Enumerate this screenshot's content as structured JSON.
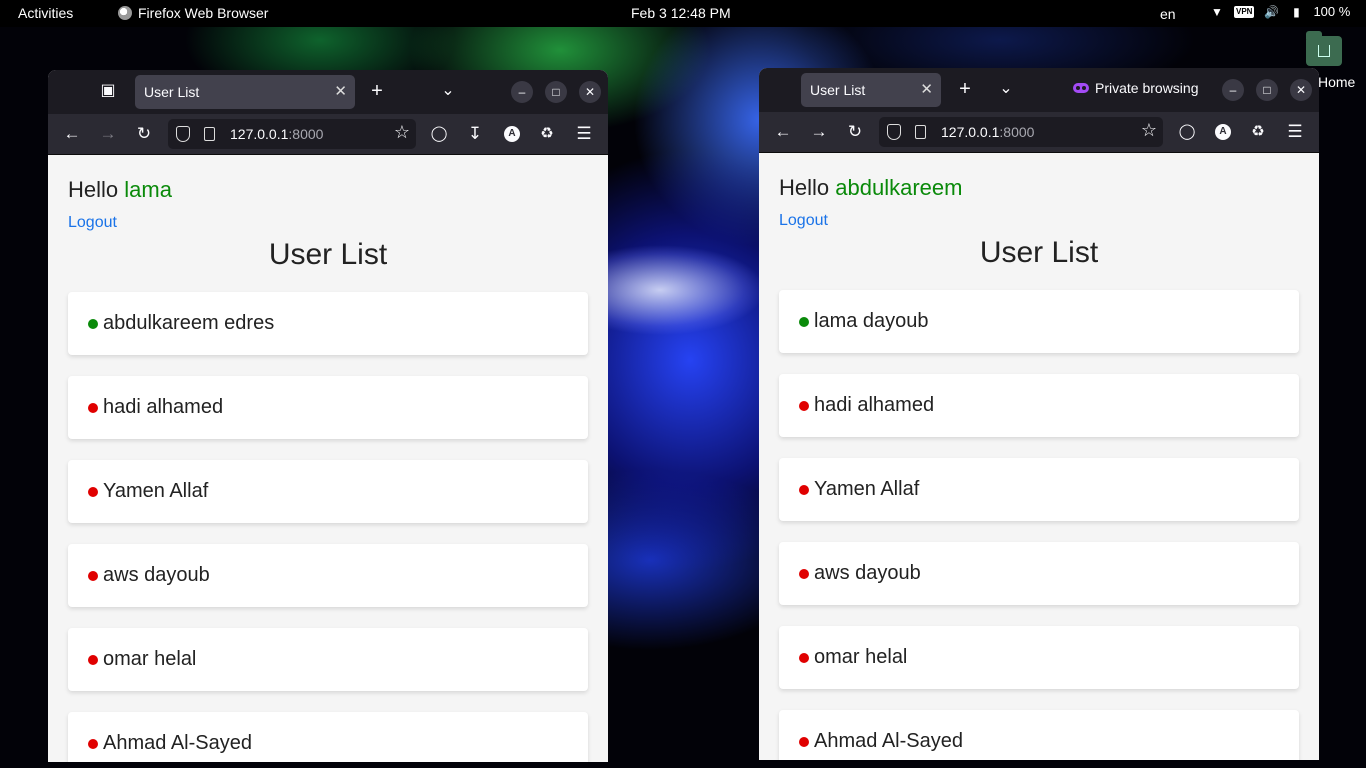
{
  "topbar": {
    "activities": "Activities",
    "app_name": "Firefox Web Browser",
    "clock": "Feb 3  12:48 PM",
    "lang": "en",
    "vpn": "VPN",
    "battery": "100 %"
  },
  "desktop": {
    "home_label": "Home"
  },
  "colors": {
    "online": "#0a8a0a",
    "offline": "#e00000",
    "link": "#1a73e8"
  },
  "left": {
    "tab_title": "User List",
    "url_host": "127.0.0.1",
    "url_port": ":8000",
    "greeting": "Hello",
    "username": "lama",
    "logout": "Logout",
    "title": "User List",
    "users": [
      {
        "name": "abdulkareem edres",
        "status": "online"
      },
      {
        "name": "hadi alhamed",
        "status": "offline"
      },
      {
        "name": "Yamen Allaf",
        "status": "offline"
      },
      {
        "name": "aws dayoub",
        "status": "offline"
      },
      {
        "name": "omar helal",
        "status": "offline"
      },
      {
        "name": "Ahmad Al-Sayed",
        "status": "offline"
      }
    ]
  },
  "right": {
    "tab_title": "User List",
    "private_label": "Private browsing",
    "url_host": "127.0.0.1",
    "url_port": ":8000",
    "greeting": "Hello",
    "username": "abdulkareem",
    "logout": "Logout",
    "title": "User List",
    "users": [
      {
        "name": "lama dayoub",
        "status": "online"
      },
      {
        "name": "hadi alhamed",
        "status": "offline"
      },
      {
        "name": "Yamen Allaf",
        "status": "offline"
      },
      {
        "name": "aws dayoub",
        "status": "offline"
      },
      {
        "name": "omar helal",
        "status": "offline"
      },
      {
        "name": "Ahmad Al-Sayed",
        "status": "offline"
      }
    ]
  }
}
